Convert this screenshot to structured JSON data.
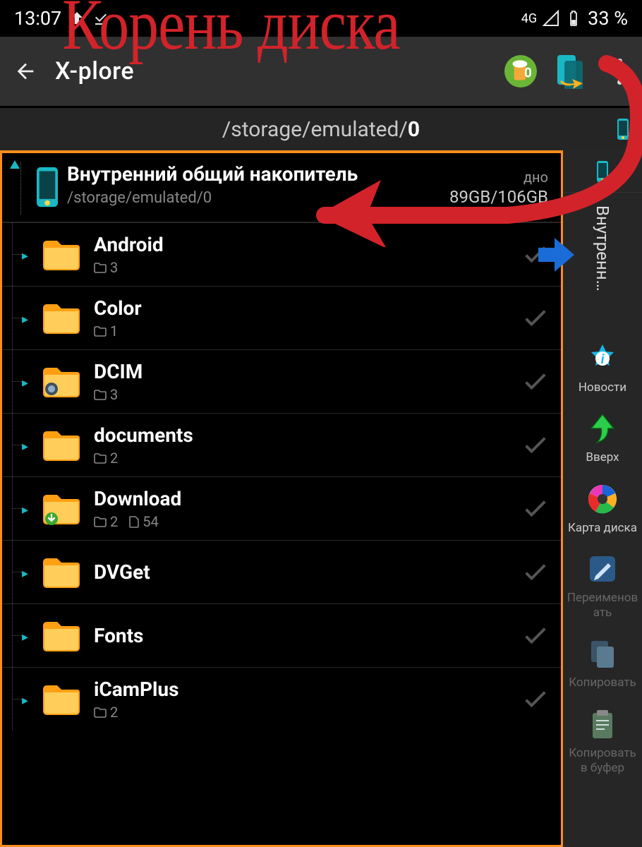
{
  "status": {
    "time": "13:07",
    "network": "4G",
    "battery": "33 %"
  },
  "appbar": {
    "title": "X-plore"
  },
  "path": {
    "prefix": "/storage/emulated/",
    "current": "0"
  },
  "storage": {
    "title": "Внутренний общий накопитель",
    "path": "/storage/emulated/0",
    "size_label": "дно",
    "size": "89GB/106GB"
  },
  "folders": [
    {
      "name": "Android",
      "dirs": "3"
    },
    {
      "name": "Color",
      "dirs": "1"
    },
    {
      "name": "DCIM",
      "dirs": "3",
      "camera": true
    },
    {
      "name": "documents",
      "dirs": "2"
    },
    {
      "name": "Download",
      "dirs": "2",
      "files": "54",
      "download": true
    },
    {
      "name": "DVGet"
    },
    {
      "name": "Fonts"
    },
    {
      "name": "iCamPlus",
      "dirs": "2"
    }
  ],
  "side": {
    "tab": "Внутренн…",
    "buttons": [
      {
        "label": "Новости",
        "type": "news"
      },
      {
        "label": "Вверх",
        "type": "up"
      },
      {
        "label": "Карта диска",
        "type": "diskmap"
      },
      {
        "label": "Переименов\nать",
        "type": "rename",
        "disabled": true
      },
      {
        "label": "Копировать",
        "type": "copy",
        "disabled": true
      },
      {
        "label": "Копировать\nв буфер",
        "type": "clip",
        "disabled": true
      }
    ]
  },
  "annotation": {
    "title": "Корень диска"
  }
}
